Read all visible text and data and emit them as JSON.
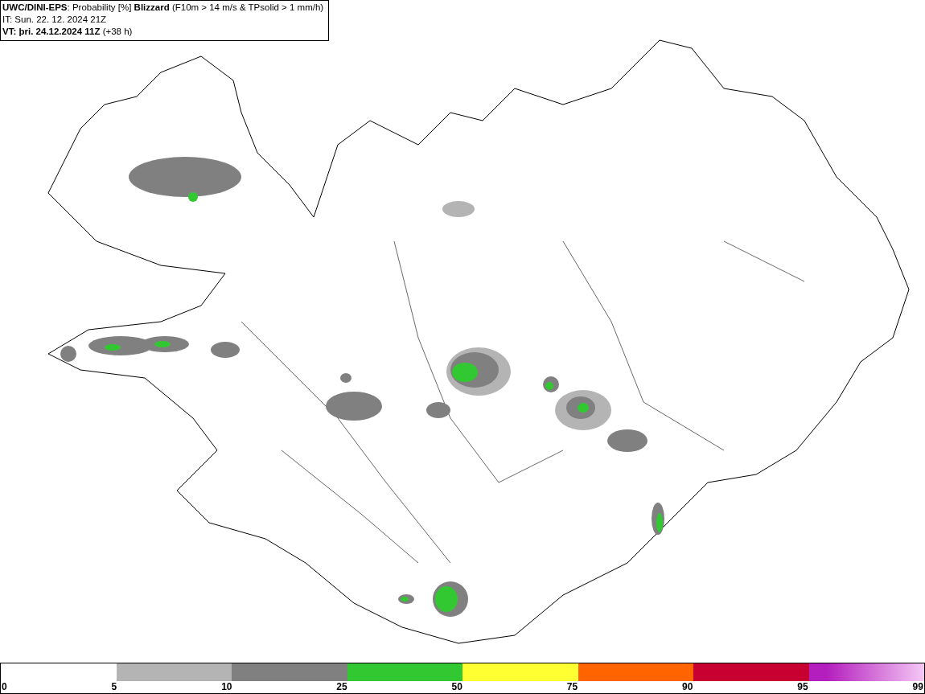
{
  "header": {
    "lines": [
      "**UWC/DINI-EPS**: Probability [%] **Blizzard** (F10m > 14 m/s & TPsolid > 1 mm/h)",
      "IT: Sun. 22. 12. 2024 21Z",
      "**VT: þri. 24.12.2024 11Z** (+38 h)"
    ]
  },
  "legend": {
    "segments": [
      {
        "color": "#b4b4b4"
      },
      {
        "color": "#808080"
      },
      {
        "color": "#32c832"
      },
      {
        "color": "#ffff32"
      },
      {
        "color": "#ff6400"
      },
      {
        "color": "#c80032"
      },
      {
        "color": "#b41ebe"
      }
    ],
    "ticks": [
      "0",
      "5",
      "10",
      "25",
      "50",
      "75",
      "90",
      "95",
      "99"
    ]
  }
}
